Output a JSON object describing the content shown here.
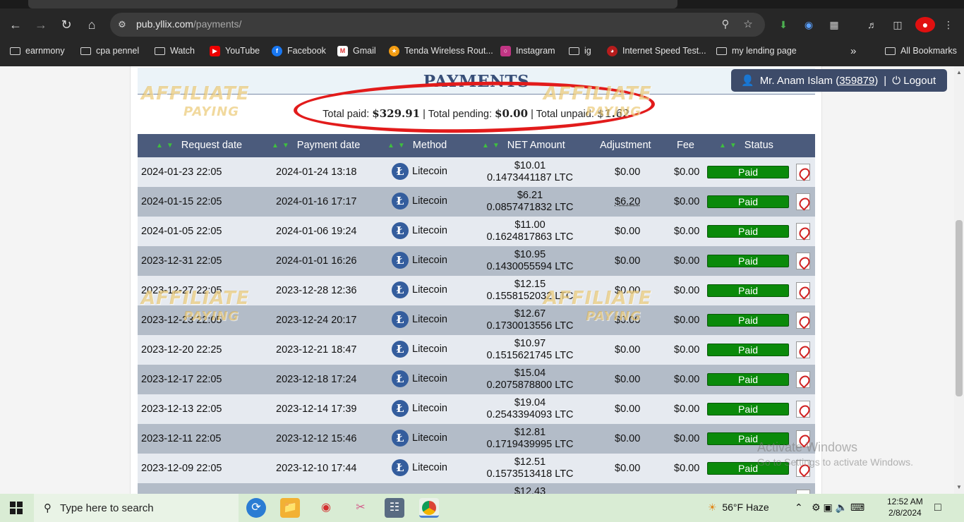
{
  "browser": {
    "url_host": "pub.yllix.com",
    "url_path": "/payments/",
    "bookmarks": [
      {
        "label": "earnmony",
        "icon": "folder-icon"
      },
      {
        "label": "cpa pennel",
        "icon": "folder-icon"
      },
      {
        "label": "Watch",
        "icon": "folder-icon"
      },
      {
        "label": "YouTube",
        "icon": "youtube-icon"
      },
      {
        "label": "Facebook",
        "icon": "facebook-icon"
      },
      {
        "label": "Gmail",
        "icon": "gmail-icon"
      },
      {
        "label": "Tenda Wireless Rout...",
        "icon": "tenda-icon"
      },
      {
        "label": "Instagram",
        "icon": "instagram-icon"
      },
      {
        "label": "ig",
        "icon": "folder-icon"
      },
      {
        "label": "Internet Speed Test...",
        "icon": "speedtest-icon"
      },
      {
        "label": "my lending page",
        "icon": "folder-icon"
      }
    ],
    "all_bookmarks": "All Bookmarks",
    "overflow": "»"
  },
  "page": {
    "title": "PAYMENTS",
    "user": {
      "name": "Mr. Anam Islam",
      "id": "359879",
      "logout": "Logout"
    },
    "totals": {
      "paid_label": "Total paid:",
      "paid": "$329.91",
      "pending_label": "Total pending:",
      "pending": "$0.00",
      "unpaid_label": "Total unpaid:",
      "unpaid": "$1.62",
      "sep": "|"
    },
    "columns": [
      "Request date",
      "Payment date",
      "Method",
      "NET Amount",
      "Adjustment",
      "Fee",
      "Status"
    ],
    "rows": [
      {
        "request": "2024-01-23 22:05",
        "payment": "2024-01-24 13:18",
        "method": "Litecoin",
        "usd": "$10.01",
        "ltc": "0.1473441187 LTC",
        "adj": "$0.00",
        "fee": "$0.00",
        "status": "Paid"
      },
      {
        "request": "2024-01-15 22:05",
        "payment": "2024-01-16 17:17",
        "method": "Litecoin",
        "usd": "$6.21",
        "ltc": "0.0857471832 LTC",
        "adj": "$6.20",
        "fee": "$0.00",
        "status": "Paid"
      },
      {
        "request": "2024-01-05 22:05",
        "payment": "2024-01-06 19:24",
        "method": "Litecoin",
        "usd": "$11.00",
        "ltc": "0.1624817863 LTC",
        "adj": "$0.00",
        "fee": "$0.00",
        "status": "Paid"
      },
      {
        "request": "2023-12-31 22:05",
        "payment": "2024-01-01 16:26",
        "method": "Litecoin",
        "usd": "$10.95",
        "ltc": "0.1430055594 LTC",
        "adj": "$0.00",
        "fee": "$0.00",
        "status": "Paid"
      },
      {
        "request": "2023-12-27 22:05",
        "payment": "2023-12-28 12:36",
        "method": "Litecoin",
        "usd": "$12.15",
        "ltc": "0.1558152032 LTC",
        "adj": "$0.00",
        "fee": "$0.00",
        "status": "Paid"
      },
      {
        "request": "2023-12-23 22:05",
        "payment": "2023-12-24 20:17",
        "method": "Litecoin",
        "usd": "$12.67",
        "ltc": "0.1730013556 LTC",
        "adj": "$0.00",
        "fee": "$0.00",
        "status": "Paid"
      },
      {
        "request": "2023-12-20 22:25",
        "payment": "2023-12-21 18:47",
        "method": "Litecoin",
        "usd": "$10.97",
        "ltc": "0.1515621745 LTC",
        "adj": "$0.00",
        "fee": "$0.00",
        "status": "Paid"
      },
      {
        "request": "2023-12-17 22:05",
        "payment": "2023-12-18 17:24",
        "method": "Litecoin",
        "usd": "$15.04",
        "ltc": "0.2075878800 LTC",
        "adj": "$0.00",
        "fee": "$0.00",
        "status": "Paid"
      },
      {
        "request": "2023-12-13 22:05",
        "payment": "2023-12-14 17:39",
        "method": "Litecoin",
        "usd": "$19.04",
        "ltc": "0.2543394093 LTC",
        "adj": "$0.00",
        "fee": "$0.00",
        "status": "Paid"
      },
      {
        "request": "2023-12-11 22:05",
        "payment": "2023-12-12 15:46",
        "method": "Litecoin",
        "usd": "$12.81",
        "ltc": "0.1719439995 LTC",
        "adj": "$0.00",
        "fee": "$0.00",
        "status": "Paid"
      },
      {
        "request": "2023-12-09 22:05",
        "payment": "2023-12-10 17:44",
        "method": "Litecoin",
        "usd": "$12.51",
        "ltc": "0.1573513418 LTC",
        "adj": "$0.00",
        "fee": "$0.00",
        "status": "Paid"
      },
      {
        "request": "",
        "payment": "",
        "method": "",
        "usd": "$12.43",
        "ltc": "",
        "adj": "",
        "fee": "",
        "status": ""
      }
    ],
    "watermark": {
      "line1": "AFFILIATE",
      "line2": "PAYING"
    },
    "activate": {
      "title": "Activate Windows",
      "sub": "Go to Settings to activate Windows."
    }
  },
  "taskbar": {
    "search_placeholder": "Type here to search",
    "weather": "56°F  Haze",
    "time": "12:52 AM",
    "date": "2/8/2024"
  },
  "colors": {
    "paid": "#0a8a0a",
    "header": "#4b5b7c",
    "circle": "#e21b1b"
  }
}
